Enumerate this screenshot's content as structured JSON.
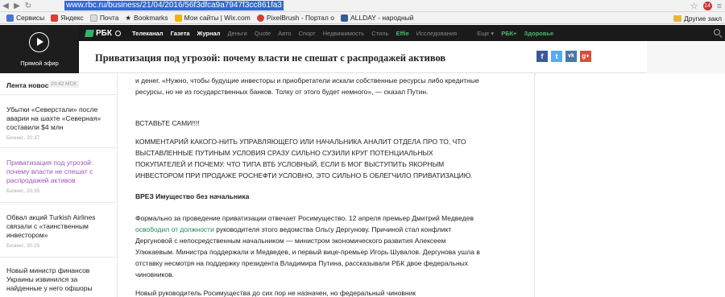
{
  "browser": {
    "url": "www.rbc.ru/business/21/04/2016/56f3dfca9a7947f3cc861fa3",
    "ext_badge": "14",
    "bookmarks": [
      {
        "label": "Сервисы",
        "color": "#4a74d8"
      },
      {
        "label": "Яндекс",
        "color": "#e23b2f"
      },
      {
        "label": "Почта",
        "color": "#888888"
      },
      {
        "label": "Bookmarks",
        "color": "#333333"
      },
      {
        "label": "Мои сайты | Wix.com",
        "color": "#f5b300"
      },
      {
        "label": "PixelBrush - Портал о",
        "color": "#d23b3b"
      },
      {
        "label": "ALLDAY - народный",
        "color": "#3a5b9a"
      }
    ],
    "other_bookmarks": "Другие закл"
  },
  "live": {
    "label": "Прямой эфир"
  },
  "nav": {
    "logo": "РБК",
    "items": [
      {
        "label": "Телеканал",
        "style": "active"
      },
      {
        "label": "Газета",
        "style": "active"
      },
      {
        "label": "Журнал",
        "style": "active"
      },
      {
        "label": "Деньги",
        "style": "dim"
      },
      {
        "label": "Quote",
        "style": "dim"
      },
      {
        "label": "Авто",
        "style": "dim"
      },
      {
        "label": "Спорт",
        "style": "dim"
      },
      {
        "label": "Недвижимость",
        "style": "dim"
      },
      {
        "label": "Стиль",
        "style": "dim"
      },
      {
        "label": "Effie",
        "style": "green"
      },
      {
        "label": "Исследования",
        "style": "dim"
      },
      {
        "label": "Еще ▾",
        "style": "dim"
      },
      {
        "label": "РБК+",
        "style": "green"
      },
      {
        "label": "Здоровье",
        "style": "green"
      }
    ]
  },
  "article": {
    "title": "Приватизация под угрозой: почему власти не спешат с распродажей активов",
    "p1": "и денег. «Нужно, чтобы будущие инвесторы и приобретатели искали собственные ресурсы либо кредитные ресурсы, но не из государственных банков. Толку от этого будет немного», — сказал Путин.",
    "p2": "ВСТАВЬТЕ САМИ!!!!",
    "p3": "КОММЕНТАРИЙ КАКОГО-НИТЬ УПРАВЛЯЮЩЕГО ИЛИ НАЧАЛЬНИКА АНАЛИТ ОТДЕЛА ПРО ТО, ЧТО ВЫСТАВЛЕННЫЕ ПУТИНЫМ УСЛОВИЯ СРАЗУ СИЛЬНО СУЗИЛИ КРУГ ПОТЕНЦИАЛЬНЫХ ПОКУПАТЕЛЕЙ И ПОЧЕМУ. ЧТО ТИПА ВТБ УСЛОВНЫЙ, ЕСЛИ Б МОГ ВЫСТУПИТЬ ЯКОРНЫМ ИНВЕСТОРОМ ПРИ ПРОДАЖЕ РОСНЕФТИ УСЛОВНО, ЭТО СИЛЬНО Б ОБЛЕГЧИЛО ПРИВАТИЗАЦИЮ.",
    "p4": "ВРЕЗ Имущество без начальника",
    "p5_a": "Формально за проведение приватизации отвечает Росимущество. 12 апреля премьер Дмитрий Медведев ",
    "p5_link": "освободил от должности",
    "p5_b": " руководителя этого ведомства Ольгу Дергунову. Причиной стал конфликт Дергуновой с непосредственным начальником — министром экономического развития Алексеем Улюкаевым. Министра поддержали и Медведев, и первый вице-премьер Игорь Шувалов. Дергунова ушла в отставку несмотря на поддержку президента Владимира Путина, рассказывали РБК двое федеральных чиновников.",
    "p6": "Новый руководитель Росимущества до сих пор не назначен, но федеральный чиновник"
  },
  "news": {
    "heading": "Лента новостей",
    "time": "20:42 МСК",
    "items": [
      {
        "text": "Убытки «Северстали» после аварии на шахте «Северная» составили $4 млн",
        "meta": "Бизнес, 20:37",
        "highlight": false
      },
      {
        "text": "Приватизация под угрозой: почему власти не спешат с распродажей активов",
        "meta": "Бизнес, 20:35",
        "highlight": true
      },
      {
        "text": "Обвал акций Turkish Airlines связали с «таинственным инвестором»",
        "meta": "Бизнес, 20:25",
        "highlight": false
      },
      {
        "text": "Новый министр финансов Украины извинился за найденные у него офшоры",
        "meta": "",
        "highlight": false
      }
    ]
  },
  "share": [
    {
      "icon": "facebook-icon",
      "glyph": "f",
      "color": "#3b5998"
    },
    {
      "icon": "twitter-icon",
      "glyph": "t",
      "color": "#55acee"
    },
    {
      "icon": "vk-icon",
      "glyph": "vk",
      "color": "#4c75a3"
    },
    {
      "icon": "google-plus-icon",
      "glyph": "g+",
      "color": "#dd4b39"
    }
  ]
}
